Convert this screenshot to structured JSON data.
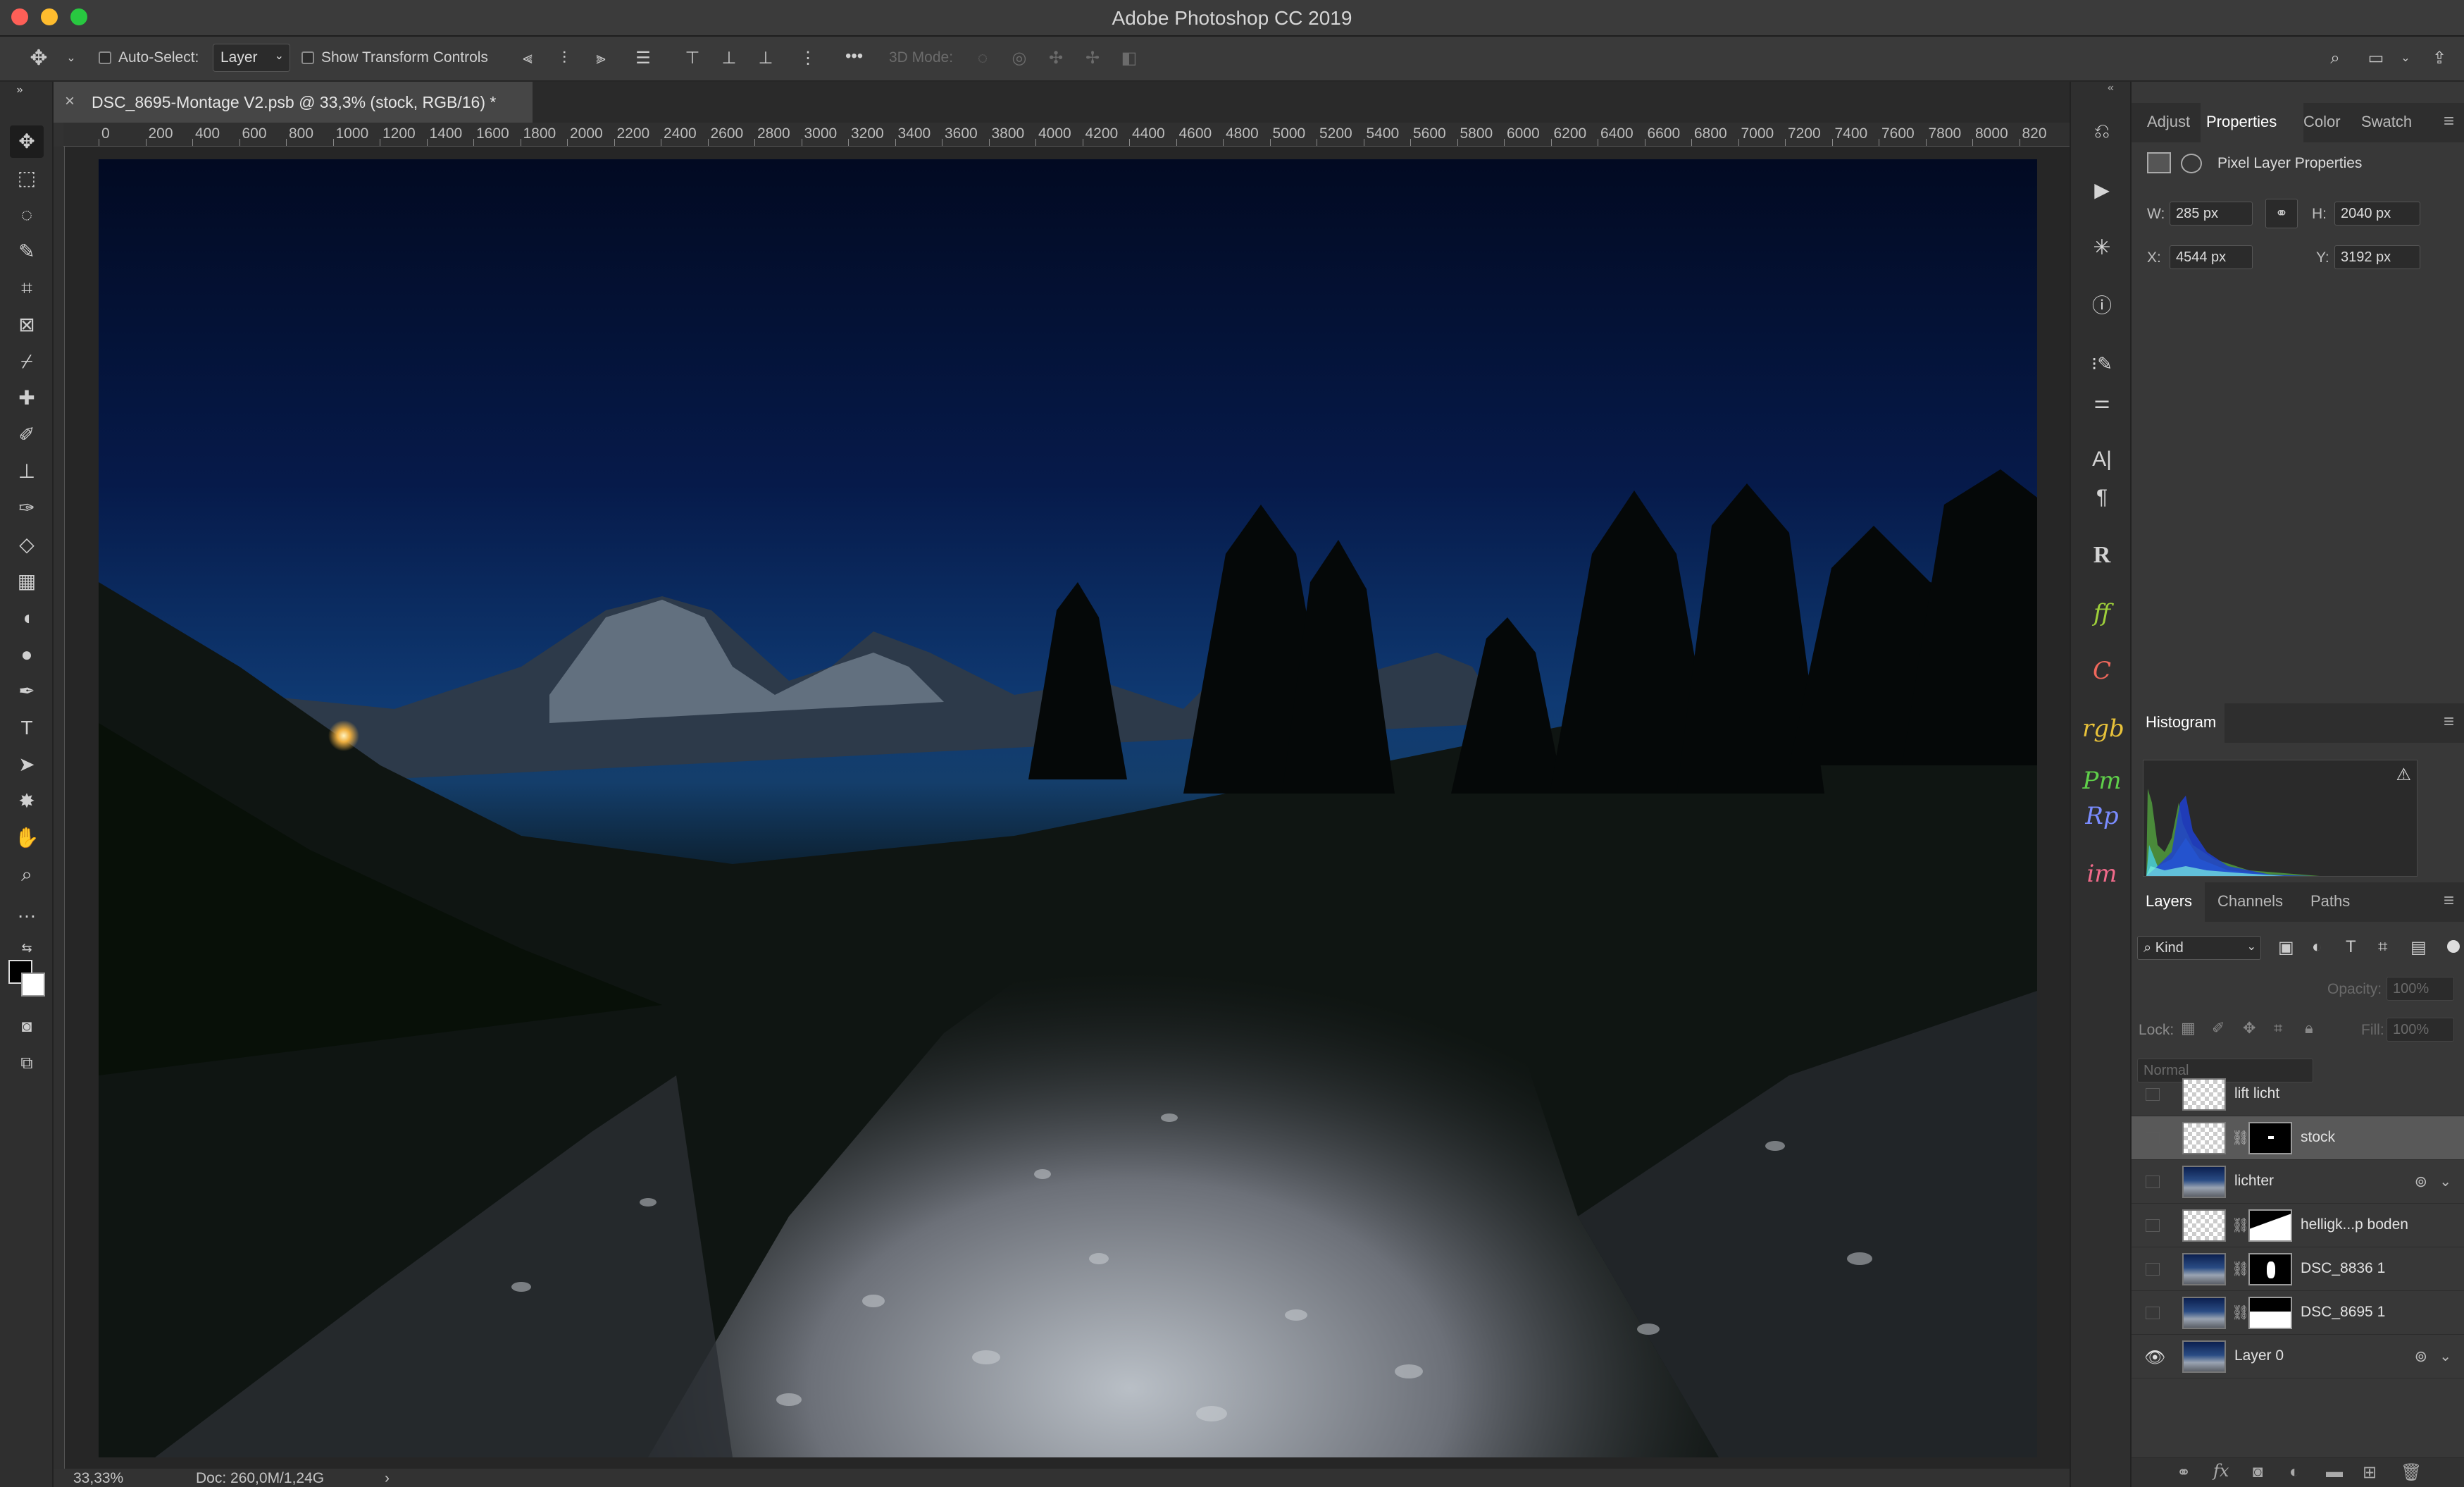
{
  "app": {
    "title": "Adobe Photoshop CC 2019",
    "traffic_colors": [
      "#fe5f57",
      "#febc2e",
      "#28c840"
    ]
  },
  "options_bar": {
    "auto_select_label": "Auto-Select:",
    "auto_select_value": "Layer",
    "show_transform_label": "Show Transform Controls",
    "more": "•••",
    "mode_3d_label": "3D Mode:"
  },
  "document": {
    "tab_title": "DSC_8695-Montage V2.psb @ 33,3% (stock, RGB/16) *"
  },
  "ruler": {
    "ticks": [
      "0",
      "200",
      "400",
      "600",
      "800",
      "1000",
      "1200",
      "1400",
      "1600",
      "1800",
      "2000",
      "2200",
      "2400",
      "2600",
      "2800",
      "3000",
      "3200",
      "3400",
      "3600",
      "3800",
      "4000",
      "4200",
      "4400",
      "4600",
      "4800",
      "5000",
      "5200",
      "5400",
      "5600",
      "5800",
      "6000",
      "6200",
      "6400",
      "6600",
      "6800",
      "7000",
      "7200",
      "7400",
      "7600",
      "7800",
      "8000",
      "820"
    ]
  },
  "status": {
    "zoom": "33,33%",
    "doc": "Doc: 260,0M/1,24G",
    "arrow": "›"
  },
  "properties_panel": {
    "tabs": [
      "Adjust",
      "Properties",
      "Color",
      "Swatch"
    ],
    "active_tab": "Properties",
    "heading": "Pixel Layer Properties",
    "w_label": "W:",
    "w_value": "285 px",
    "h_label": "H:",
    "h_value": "2040 px",
    "x_label": "X:",
    "x_value": "4544 px",
    "y_label": "Y:",
    "y_value": "3192 px"
  },
  "histogram_panel": {
    "tab": "Histogram",
    "warning": "⚠"
  },
  "layers_panel": {
    "tabs": [
      "Layers",
      "Channels",
      "Paths"
    ],
    "kind_label": "Kind",
    "blend_mode": "Normal",
    "opacity_label": "Opacity:",
    "opacity_value": "100%",
    "lock_label": "Lock:",
    "fill_label": "Fill:",
    "fill_value": "100%",
    "layers": [
      {
        "name": "lift licht"
      },
      {
        "name": "stock"
      },
      {
        "name": "lichter"
      },
      {
        "name": "helligk...p boden"
      },
      {
        "name": "DSC_8836 1"
      },
      {
        "name": "DSC_8695 1"
      },
      {
        "name": "Layer 0"
      }
    ],
    "selected_layer": "stock",
    "visible_layer": "Layer 0"
  },
  "strip": {
    "icons": [
      "R",
      "ff",
      "C",
      "rgb",
      "Pm",
      "Rp",
      "im"
    ],
    "icon_colors": {
      "ff": "#9ecf3a",
      "C": "#f0685c",
      "rgb": "#e8c23a",
      "Pm": "#5fcf4a",
      "Rp": "#7a8cff",
      "im": "#f06a8a",
      "R": "#d9d9d9"
    }
  }
}
